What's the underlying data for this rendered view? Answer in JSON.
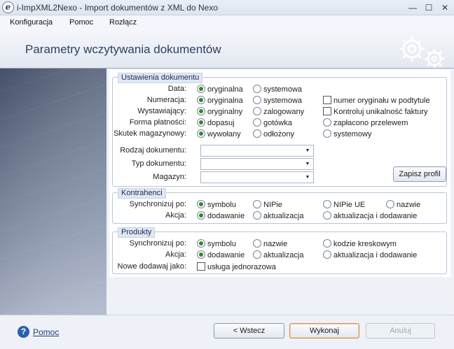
{
  "window": {
    "title": "i-ImpXML2Nexo - Import dokumentów z XML do Nexo",
    "logo": "e",
    "minimize": "—",
    "maximize": "☐",
    "close": "✕"
  },
  "menu": [
    "Konfiguracja",
    "Pomoc",
    "Rozłącz"
  ],
  "header": {
    "title": "Parametry wczytywania dokumentów"
  },
  "dokument": {
    "legend": "Ustawienia dokumentu",
    "rows": [
      {
        "label": "Data:",
        "options": [
          "oryginalna",
          "systemowa"
        ],
        "selected": 0,
        "extra": null
      },
      {
        "label": "Numeracja:",
        "options": [
          "oryginalna",
          "systemowa"
        ],
        "selected": 0,
        "extra": "numer oryginału w podtytule"
      },
      {
        "label": "Wystawiający:",
        "options": [
          "oryginalny",
          "zalogowany"
        ],
        "selected": 0,
        "extra": "Kontroluj unikalność faktury"
      },
      {
        "label": "Forma płatności:",
        "options": [
          "dopasuj",
          "gotówka",
          "zapłacono przelewem"
        ],
        "selected": 0
      },
      {
        "label": "Skutek magazynowy:",
        "options": [
          "wywołany",
          "odłożony",
          "systemowy"
        ],
        "selected": 0
      }
    ],
    "combos": [
      {
        "label": "Rodzaj dokumentu:",
        "value": ""
      },
      {
        "label": "Typ dokumentu:",
        "value": ""
      },
      {
        "label": "Magazyn:",
        "value": ""
      }
    ],
    "save_button": "Zapisz profil"
  },
  "kontrahenci": {
    "legend": "Kontrahenci",
    "sync_label": "Synchronizuj po:",
    "sync_options": [
      "symbolu",
      "NIPie",
      "NIPie UE",
      "nazwie"
    ],
    "sync_selected": 0,
    "action_label": "Akcja:",
    "action_options": [
      "dodawanie",
      "aktualizacja",
      "aktualizacja i dodawanie"
    ],
    "action_selected": 0
  },
  "produkty": {
    "legend": "Produkty",
    "sync_label": "Synchronizuj po:",
    "sync_options": [
      "symbolu",
      "nazwie",
      "kodzie kreskowym"
    ],
    "sync_selected": 0,
    "action_label": "Akcja:",
    "action_options": [
      "dodawanie",
      "aktualizacja",
      "aktualizacja i dodawanie"
    ],
    "action_selected": 0,
    "new_label": "Nowe dodawaj jako:",
    "new_option": "usługa jednorazowa"
  },
  "footer": {
    "help": "Pomoc",
    "help_icon": "?",
    "back": "<  Wstecz",
    "execute": "Wykonaj",
    "cancel": "Anuluj"
  },
  "colors": {
    "accent": "#2d3f62",
    "radio_selected": "#2b8a2b"
  }
}
